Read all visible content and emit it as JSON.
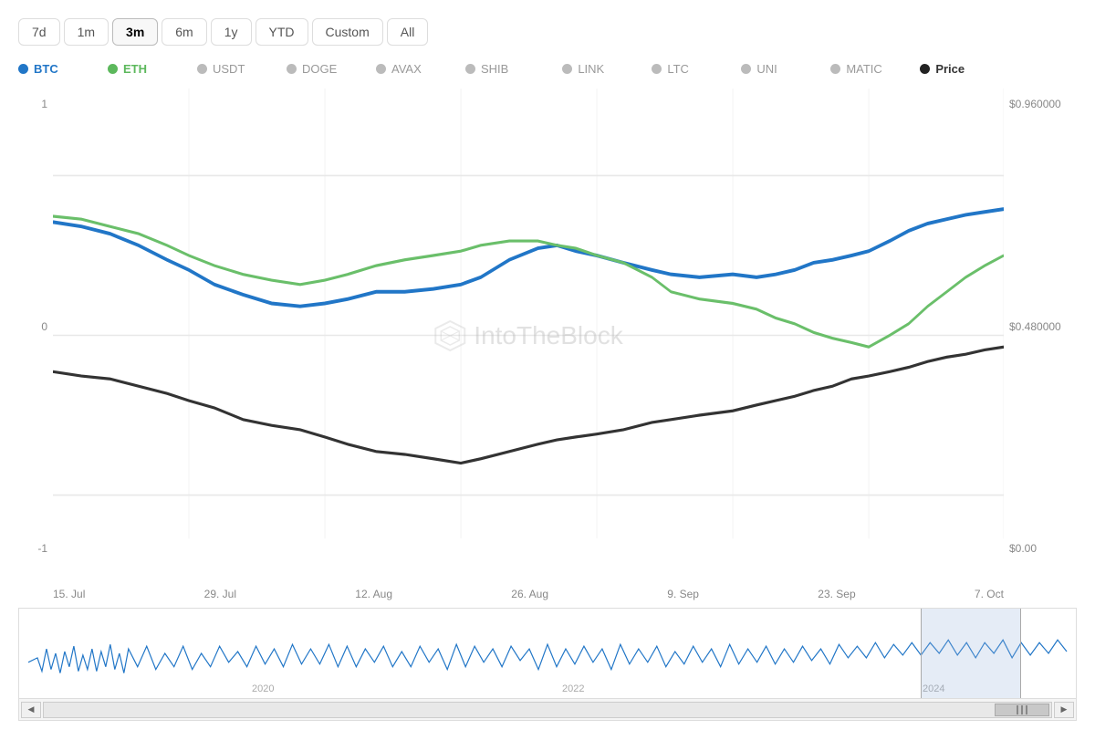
{
  "timeRange": {
    "buttons": [
      "7d",
      "1m",
      "3m",
      "6m",
      "1y",
      "YTD",
      "Custom",
      "All"
    ],
    "active": "3m"
  },
  "legend": {
    "row1": [
      {
        "id": "BTC",
        "color": "#2176c7",
        "active": true
      },
      {
        "id": "ETH",
        "color": "#5cb85c",
        "active": true
      },
      {
        "id": "USDT",
        "color": "#bbb",
        "active": false
      },
      {
        "id": "DOGE",
        "color": "#bbb",
        "active": false
      },
      {
        "id": "AVAX",
        "color": "#bbb",
        "active": false
      },
      {
        "id": "SHIB",
        "color": "#bbb",
        "active": false
      }
    ],
    "row2": [
      {
        "id": "LINK",
        "color": "#bbb",
        "active": false
      },
      {
        "id": "LTC",
        "color": "#bbb",
        "active": false
      },
      {
        "id": "UNI",
        "color": "#bbb",
        "active": false
      },
      {
        "id": "MATIC",
        "color": "#bbb",
        "active": false
      },
      {
        "id": "Price",
        "color": "#222",
        "active": true,
        "bold": true
      }
    ]
  },
  "yAxis": {
    "left": [
      "1",
      "0",
      "-1"
    ],
    "right": [
      "$0.960000",
      "$0.480000",
      "$0.00"
    ]
  },
  "xAxis": {
    "labels": [
      "15. Jul",
      "29. Jul",
      "12. Aug",
      "26. Aug",
      "9. Sep",
      "23. Sep",
      "7. Oct"
    ]
  },
  "watermark": {
    "logo": "⬡",
    "text": "IntoTheBlock"
  },
  "overviewYears": [
    "2020",
    "2022",
    "2024"
  ],
  "scrollbar": {
    "leftArrow": "◀",
    "rightArrow": "▶",
    "gripChar": "|||"
  }
}
